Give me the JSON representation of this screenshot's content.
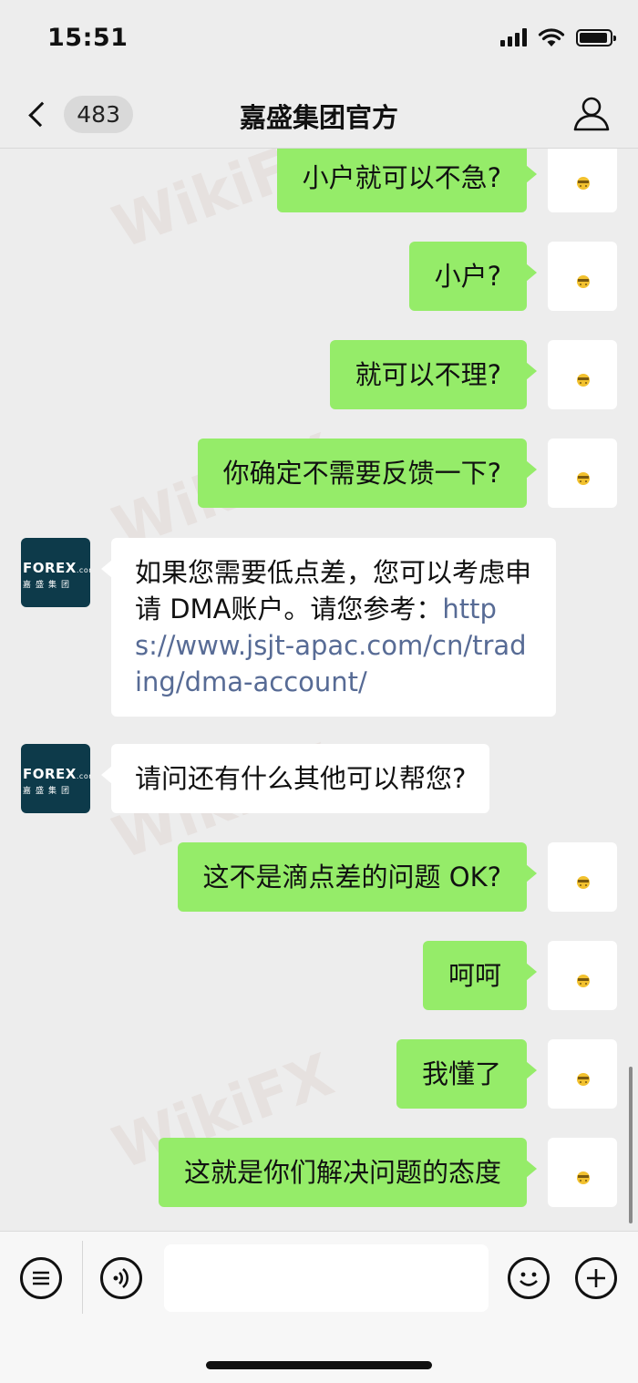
{
  "status_bar": {
    "time": "15:51"
  },
  "nav": {
    "unread_count": "483",
    "title": "嘉盛集团官方"
  },
  "avatar_them": {
    "logo": "FOREX",
    "logo_suffix": ".com",
    "logo_sub": "嘉盛集团"
  },
  "messages": [
    {
      "from": "me",
      "text": "小户就可以不急?"
    },
    {
      "from": "me",
      "text": "小户?"
    },
    {
      "from": "me",
      "text": "就可以不理?"
    },
    {
      "from": "me",
      "text": "你确定不需要反馈一下?"
    },
    {
      "from": "them",
      "text": "如果您需要低点差，您可以考虑申请 DMA账户。请您参考：",
      "link": "https://www.jsjt-apac.com/cn/trading/dma-account/"
    },
    {
      "from": "them",
      "text": "请问还有什么其他可以帮您?"
    },
    {
      "from": "me",
      "text": "这不是滴点差的问题 OK?"
    },
    {
      "from": "me",
      "text": "呵呵"
    },
    {
      "from": "me",
      "text": "我懂了"
    },
    {
      "from": "me",
      "text": "这就是你们解决问题的态度"
    }
  ],
  "watermark": "WikiFX",
  "input": {
    "value": ""
  }
}
